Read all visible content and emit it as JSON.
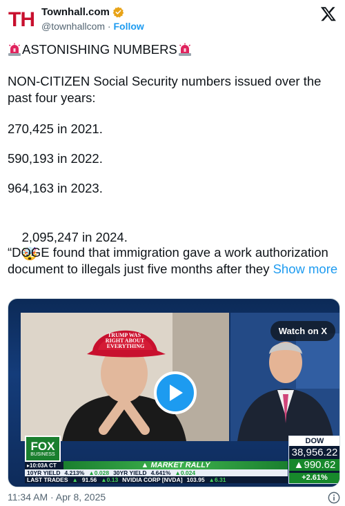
{
  "account": {
    "display_name": "Townhall.com",
    "handle": "@townhallcom",
    "separator": "·",
    "follow_label": "Follow",
    "avatar_text": "TH"
  },
  "tweet": {
    "title": "ASTONISHING NUMBERS",
    "intro": "NON-CITIZEN Social Security numbers issued over the past four years:",
    "stats": [
      "270,425 in 2021.",
      "590,193 in 2022.",
      "964,163 in 2023.",
      "2,095,247 in 2024."
    ],
    "emoji_after_last": "🤯",
    "quote": "“DOGE found that immigration gave a work authorization document to illegals just five months after they ",
    "show_more": "Show more"
  },
  "media": {
    "watch_label": "Watch on X",
    "hat_text": [
      "TRUMP WAS",
      "RIGHT ABOUT",
      "EVERYTHING"
    ],
    "network": "FOX",
    "network_sub": "BUSINESS",
    "time": "10:03A CT",
    "banner": "MARKET RALLY",
    "yield_row": [
      "10YR YIELD",
      "4.213%",
      "0.028",
      "30YR YIELD",
      "4.641%",
      "0.024"
    ],
    "trades_row": [
      "LAST TRADES",
      "91.56",
      "0.13",
      "NVIDIA CORP [NVDA]",
      "103.95",
      "6.31"
    ],
    "dow": {
      "label": "DOW",
      "value": "38,956.22",
      "change": "990.62",
      "percent": "+2.61%"
    }
  },
  "footer": {
    "timestamp": "11:34 AM · Apr 8, 2025"
  },
  "colors": {
    "link": "#1d9bf0",
    "verified": "#e8a317",
    "brand": "#c8102e",
    "fox_green": "#1a7f2e"
  }
}
